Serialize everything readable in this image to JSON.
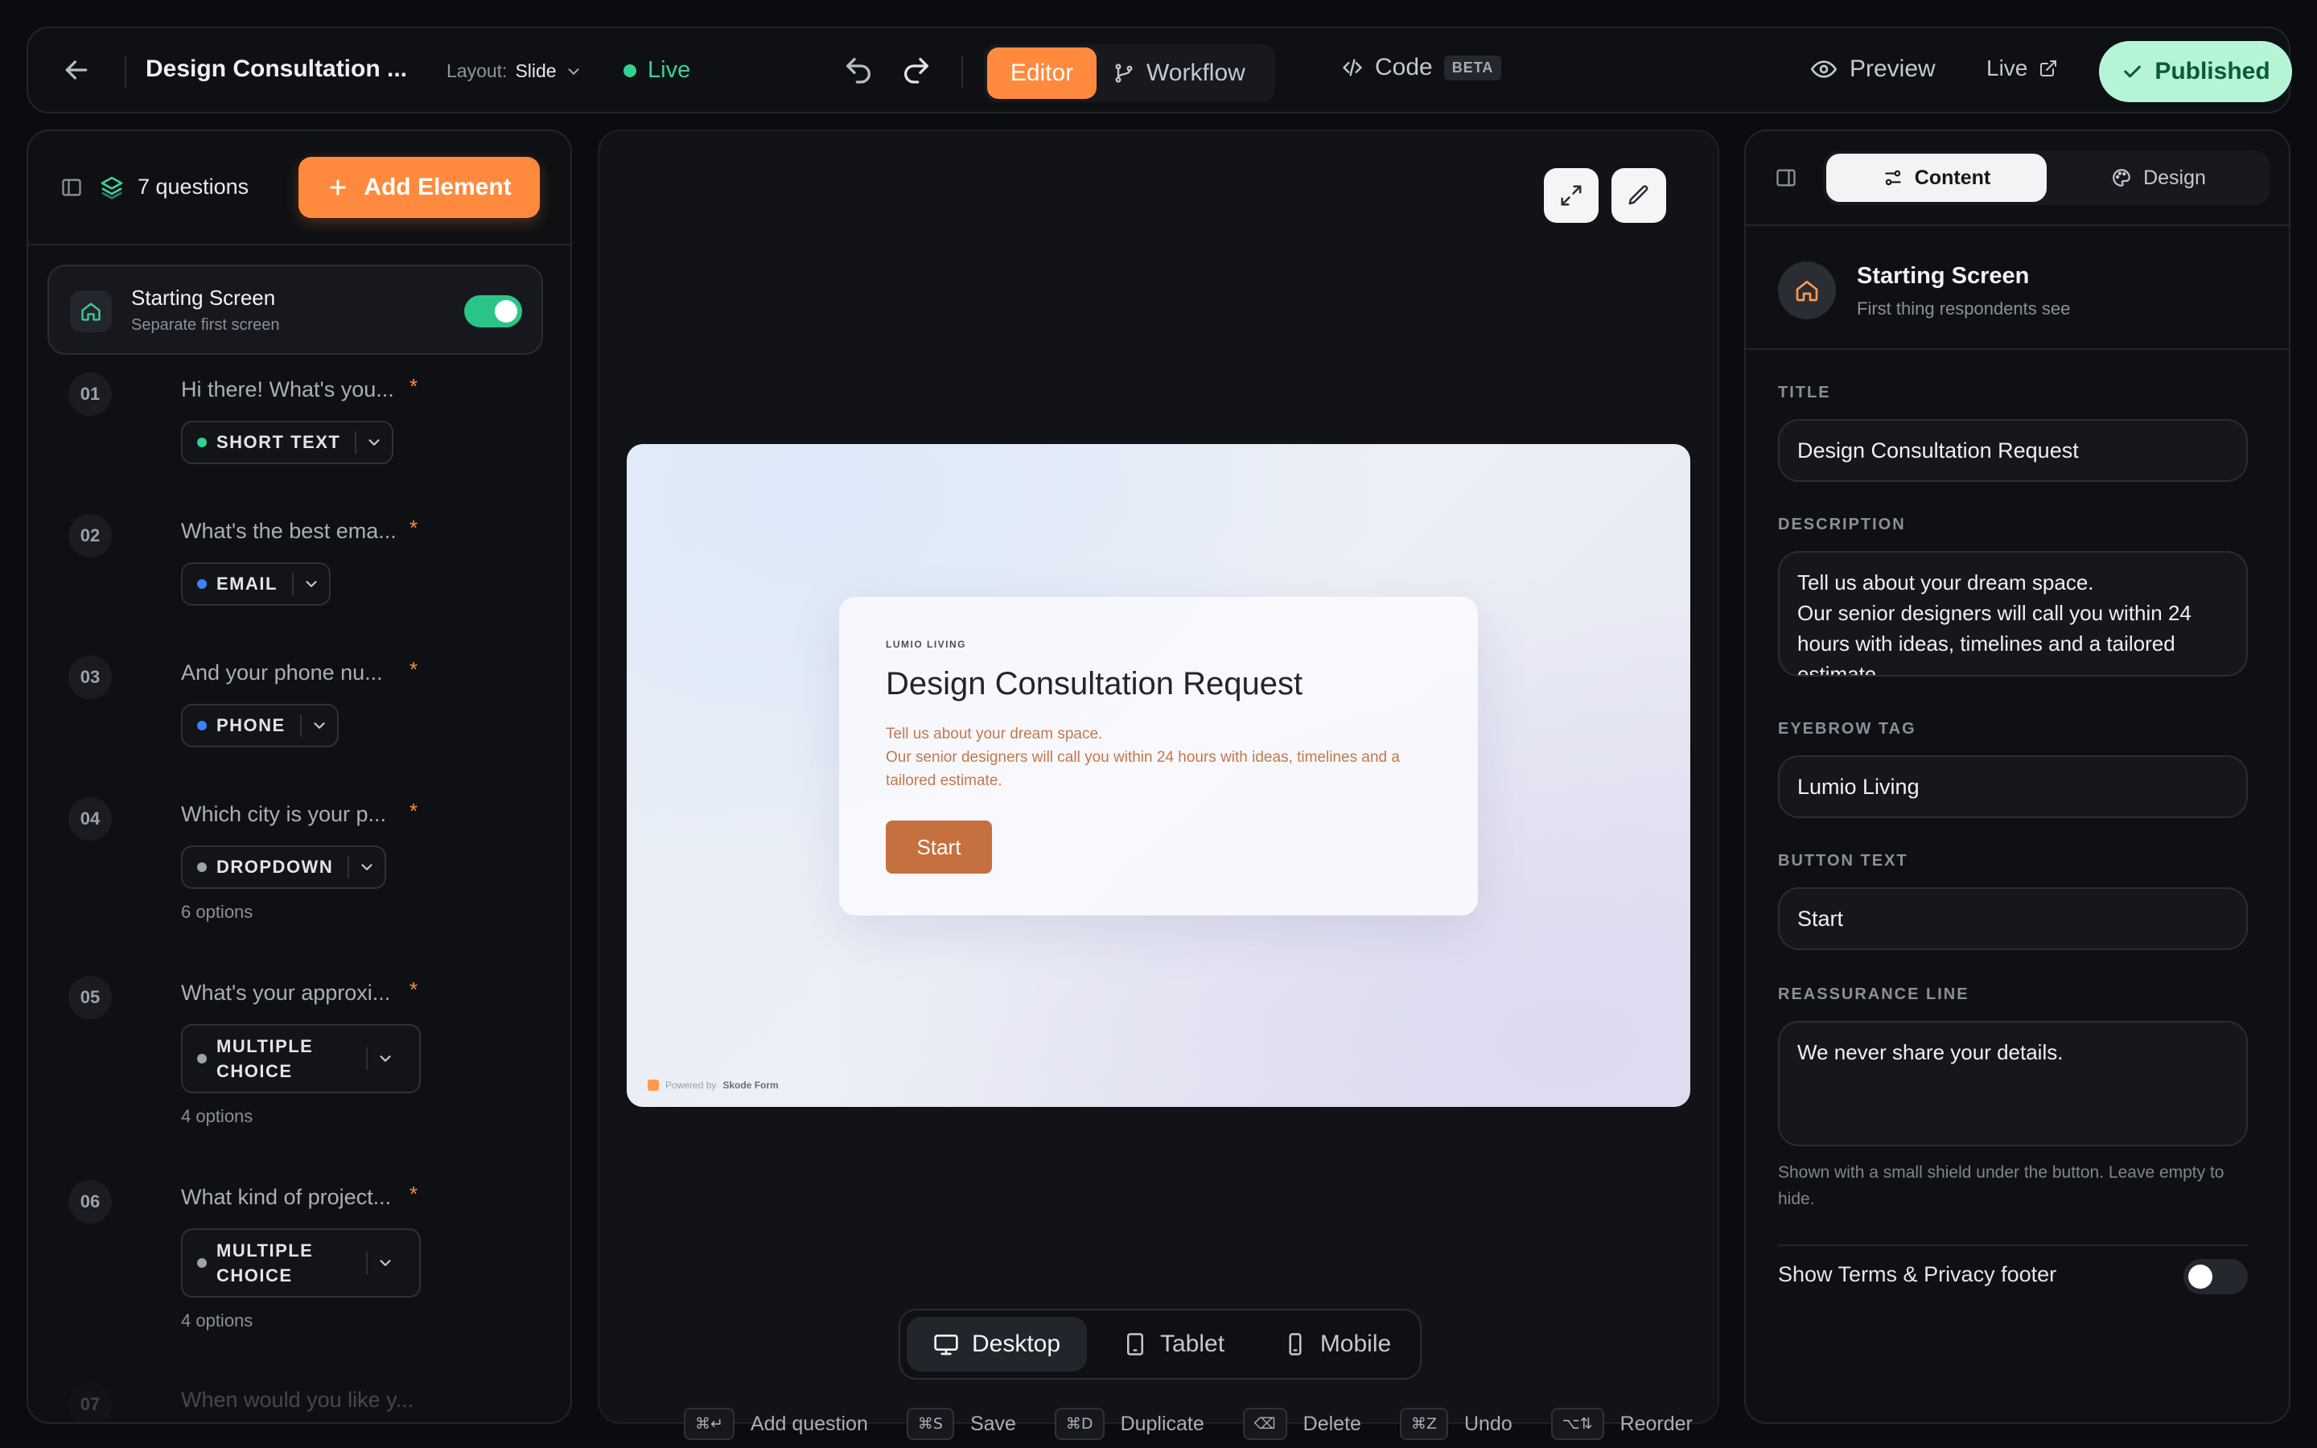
{
  "topbar": {
    "title": "Design Consultation ...",
    "layout_label": "Layout:",
    "layout_value": "Slide",
    "live_status": "Live",
    "editor": "Editor",
    "workflow": "Workflow",
    "code": "Code",
    "beta": "BETA",
    "preview": "Preview",
    "live_link": "Live",
    "published": "Published"
  },
  "sidebar": {
    "count": "7 questions",
    "add_element": "Add Element",
    "starting_screen": {
      "title": "Starting Screen",
      "subtitle": "Separate first screen",
      "enabled": true
    },
    "questions": [
      {
        "num": "01",
        "text": "Hi there! What's you...",
        "type": "SHORT TEXT",
        "dot": "#2fd291",
        "options": ""
      },
      {
        "num": "02",
        "text": "What's the best ema...",
        "type": "EMAIL",
        "dot": "#3b82f6",
        "options": ""
      },
      {
        "num": "03",
        "text": "And your phone nu...",
        "type": "PHONE",
        "dot": "#3b82f6",
        "options": ""
      },
      {
        "num": "04",
        "text": "Which city is your p...",
        "type": "DROPDOWN",
        "dot": "#9ca3af",
        "options": "6 options"
      },
      {
        "num": "05",
        "text": "What's your approxi...",
        "type_line1": "MULTIPLE",
        "type_line2": "CHOICE",
        "dot": "#9ca3af",
        "options": "4 options"
      },
      {
        "num": "06",
        "text": "What kind of project...",
        "type_line1": "MULTIPLE",
        "type_line2": "CHOICE",
        "dot": "#9ca3af",
        "options": "4 options"
      },
      {
        "num": "07",
        "text": "When would you like y..."
      }
    ]
  },
  "preview": {
    "eyebrow": "LUMIO LIVING",
    "title": "Design Consultation Request",
    "description": "Tell us about your dream space.\nOur senior designers will call you within 24 hours with ideas, timelines and a tailored estimate.",
    "button": "Start",
    "powered_prefix": "Powered by",
    "powered_brand": "Skode Form"
  },
  "devices": {
    "desktop": "Desktop",
    "tablet": "Tablet",
    "mobile": "Mobile",
    "active": "desktop"
  },
  "shortcuts": [
    {
      "key": "⌘↵",
      "label": "Add question"
    },
    {
      "key": "⌘S",
      "label": "Save"
    },
    {
      "key": "⌘D",
      "label": "Duplicate"
    },
    {
      "key": "⌫",
      "label": "Delete"
    },
    {
      "key": "⌘Z",
      "label": "Undo"
    },
    {
      "key": "⌥⇅",
      "label": "Reorder"
    }
  ],
  "inspector": {
    "tab_content": "Content",
    "tab_design": "Design",
    "section_title": "Starting Screen",
    "section_sub": "First thing respondents see",
    "title_label": "TITLE",
    "title_value": "Design Consultation Request",
    "description_label": "DESCRIPTION",
    "description_value": "Tell us about your dream space.\nOur senior designers will call you within 24 hours with ideas, timelines and a tailored estimate.",
    "eyebrow_label": "EYEBROW TAG",
    "eyebrow_value": "Lumio Living",
    "button_label": "BUTTON TEXT",
    "button_value": "Start",
    "reassurance_label": "REASSURANCE LINE",
    "reassurance_value": "We never share your details.",
    "reassurance_hint": "Shown with a small shield under the button. Leave empty to hide.",
    "terms_label": "Show Terms & Privacy footer",
    "terms_enabled": false
  },
  "colors": {
    "accent": "#ff8a3d",
    "live": "#2fd291",
    "published_bg": "#b5f5d6"
  }
}
